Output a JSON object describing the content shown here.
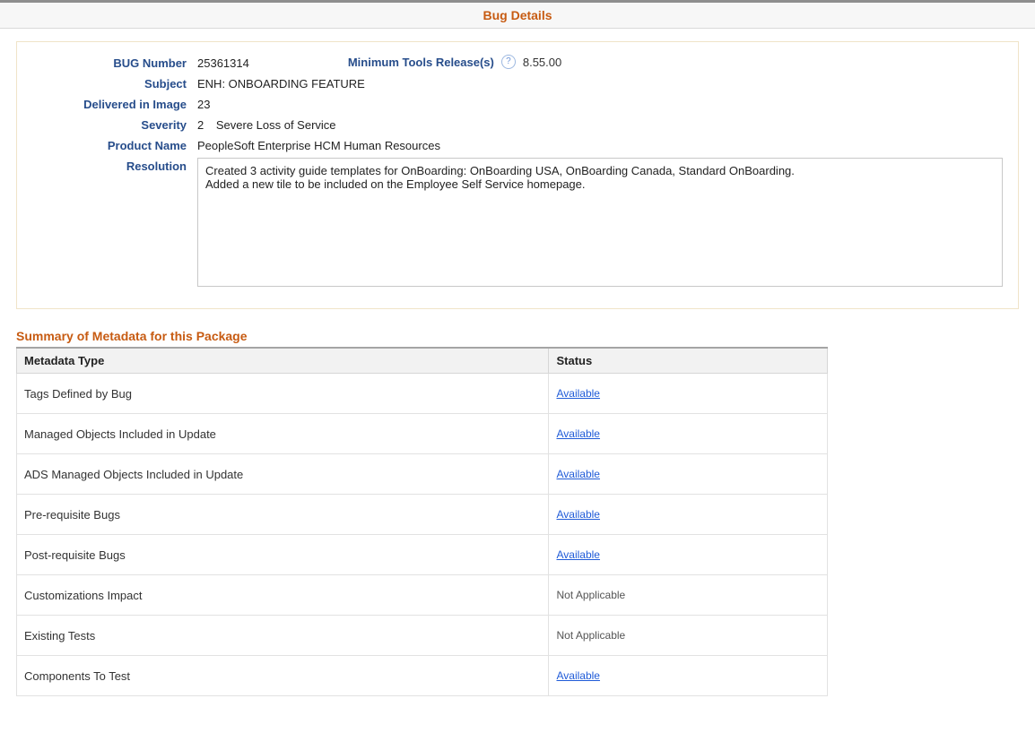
{
  "title": "Bug Details",
  "labels": {
    "bug_number": "BUG Number",
    "subject": "Subject",
    "delivered": "Delivered in Image",
    "severity": "Severity",
    "product_name": "Product Name",
    "resolution": "Resolution",
    "min_tools": "Minimum Tools Release(s)"
  },
  "bug": {
    "number": "25361314",
    "min_tools_release": "8.55.00",
    "subject": "ENH: ONBOARDING FEATURE",
    "delivered_in_image": "23",
    "severity_code": "2",
    "severity_text": "Severe Loss of Service",
    "product_name": "PeopleSoft Enterprise HCM Human Resources",
    "resolution": "Created 3 activity guide templates for OnBoarding:  OnBoarding USA, OnBoarding Canada, Standard OnBoarding.\nAdded a new tile to be included on the Employee Self Service homepage."
  },
  "help_icon_glyph": "?",
  "summary": {
    "heading": "Summary of Metadata for this Package",
    "columns": {
      "type": "Metadata Type",
      "status": "Status"
    },
    "rows": [
      {
        "type": "Tags Defined by Bug",
        "status": "Available",
        "link": true
      },
      {
        "type": "Managed Objects Included in Update",
        "status": "Available",
        "link": true
      },
      {
        "type": "ADS Managed Objects Included in Update",
        "status": "Available",
        "link": true
      },
      {
        "type": "Pre-requisite Bugs",
        "status": "Available",
        "link": true
      },
      {
        "type": "Post-requisite Bugs",
        "status": "Available",
        "link": true
      },
      {
        "type": "Customizations Impact",
        "status": "Not Applicable",
        "link": false
      },
      {
        "type": "Existing Tests",
        "status": "Not Applicable",
        "link": false
      },
      {
        "type": "Components To Test",
        "status": "Available",
        "link": true
      }
    ]
  }
}
